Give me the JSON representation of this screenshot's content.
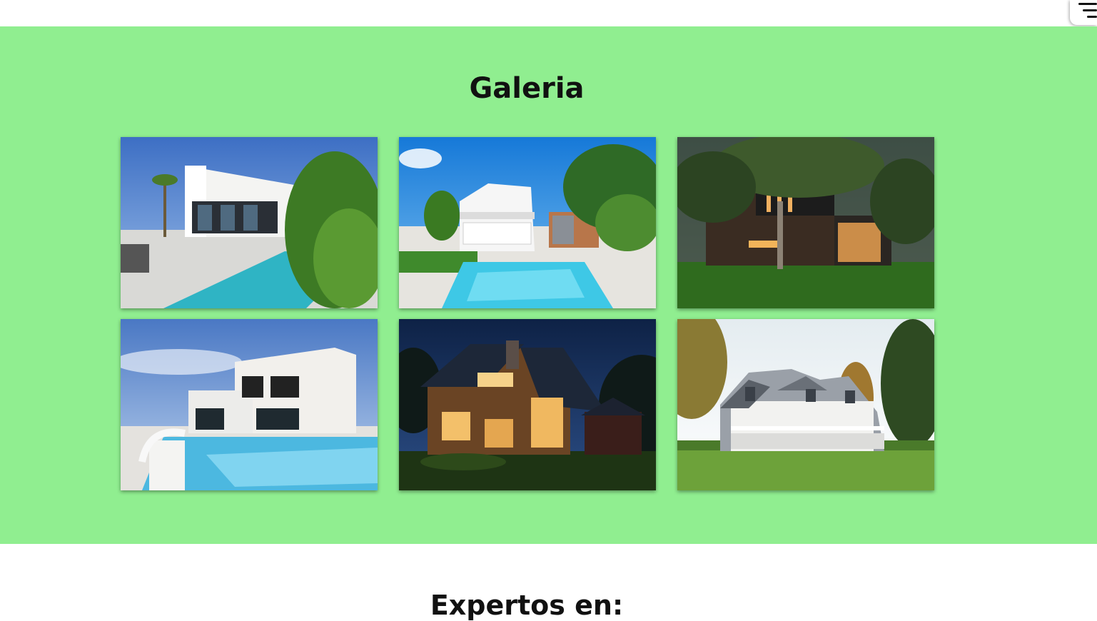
{
  "menu": {
    "icon": "hamburger-menu-icon"
  },
  "gallery": {
    "title": "Galeria",
    "background": "#90ee90",
    "images": [
      {
        "name": "modern-white-house-pool-photo"
      },
      {
        "name": "white-colonial-house-pool-photo"
      },
      {
        "name": "dark-modern-house-tree-photo"
      },
      {
        "name": "white-villa-pool-photo"
      },
      {
        "name": "wooden-house-night-photo"
      },
      {
        "name": "white-porch-house-lawn-photo"
      }
    ]
  },
  "next_section": {
    "title": "Expertos en:"
  }
}
